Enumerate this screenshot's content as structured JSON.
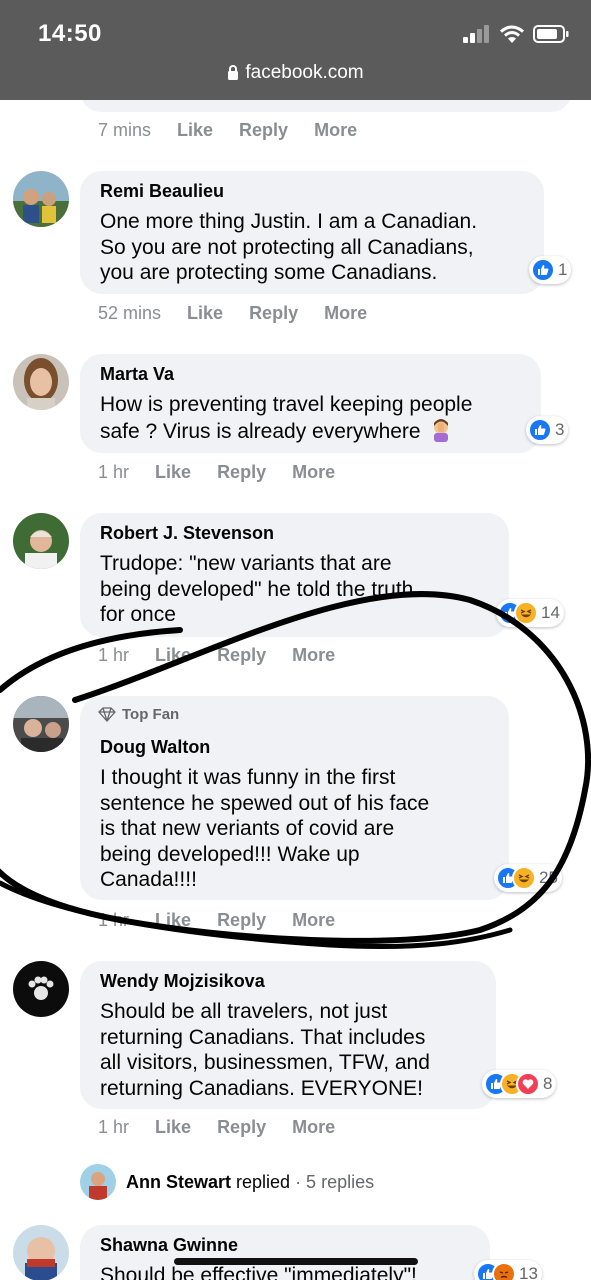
{
  "status_bar": {
    "time": "14:50",
    "url": "facebook.com"
  },
  "prev_comment": {
    "time": "7 mins",
    "like": "Like",
    "reply": "Reply",
    "more": "More"
  },
  "comments": [
    {
      "name": "Remi Beaulieu",
      "text": "One more thing Justin. I am a Canadian.\nSo you are not protecting all Canadians,\nyou are protecting some Canadians.",
      "reaction_count": "1",
      "time": "52 mins"
    },
    {
      "name": "Marta Va",
      "text": "How is preventing travel keeping people\nsafe ? Virus is already everywhere",
      "reaction_count": "3",
      "time": "1 hr"
    },
    {
      "name": "Robert J. Stevenson",
      "text": "Trudope: \"new variants that are\nbeing developed\" he told the truth\nfor once",
      "reaction_count": "14",
      "time": "1 hr"
    },
    {
      "badge": "Top Fan",
      "name": "Doug Walton",
      "text": "I thought it was funny in the first\nsentence he spewed out of his face\nis that new veriants of covid are\nbeing developed!!! Wake up\nCanada!!!!",
      "reaction_count": "25",
      "time": "1 hr"
    },
    {
      "name": "Wendy Mojzisikova",
      "text": "Should be all travelers, not just\nreturning Canadians. That includes\nall visitors, businessmen, TFW, and\nreturning Canadians. EVERYONE!",
      "reaction_count": "8",
      "time": "1 hr"
    },
    {
      "name": "Shawna Gwinne",
      "text": "Should be effective \"immediately\"!",
      "reaction_count": "13"
    }
  ],
  "actions": {
    "like": "Like",
    "reply": "Reply",
    "more": "More"
  },
  "replies_row": {
    "name": "Ann Stewart",
    "verb": "replied",
    "count": "· 5 replies"
  },
  "colors": {
    "status_bg": "#5b5b5b",
    "bubble": "#f0f2f5",
    "like_blue": "#1877f2",
    "meta_gray": "#8a8d91"
  }
}
